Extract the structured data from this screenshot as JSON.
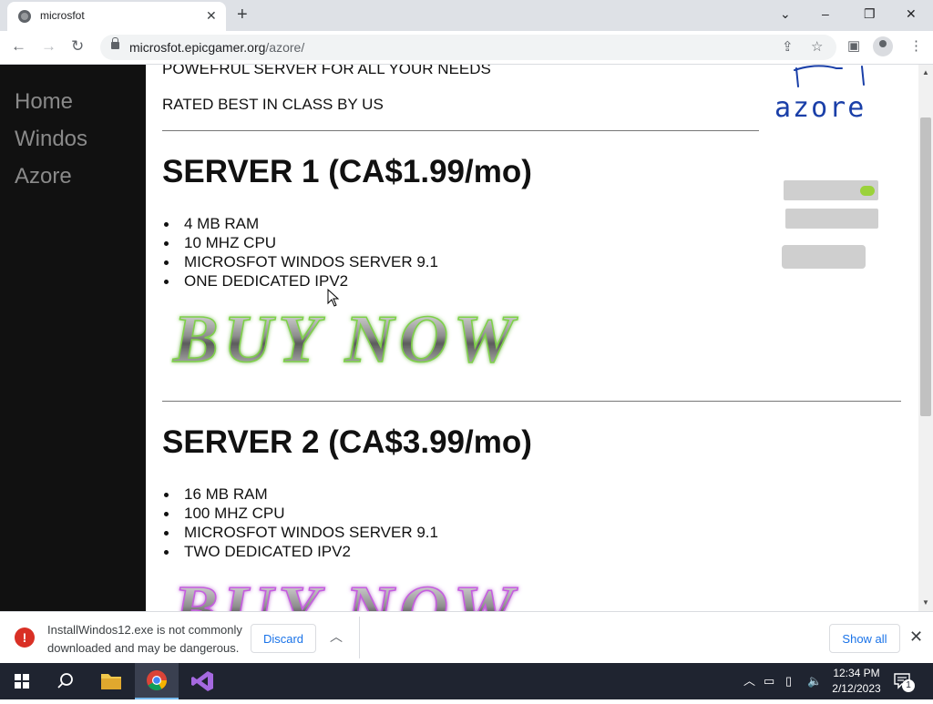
{
  "browser": {
    "tab_title": "microsfot",
    "url_host": "microsfot.epicgamer.org",
    "url_path": "/azore/"
  },
  "sidebar": {
    "items": [
      {
        "label": "Home"
      },
      {
        "label": "Windos"
      },
      {
        "label": "Azore"
      }
    ]
  },
  "page": {
    "tagline": "POWEFRUL SERVER FOR ALL YOUR NEEDS",
    "rating": "RATED BEST IN CLASS BY US",
    "logo_text": "azore",
    "buy_button_text": "BUY NOW",
    "servers": [
      {
        "title": "SERVER 1 (CA$1.99/mo)",
        "features": [
          "4 MB RAM",
          "10 MHZ CPU",
          "MICROSFOT WINDOS SERVER 9.1",
          "ONE DEDICATED IPV2"
        ]
      },
      {
        "title": "SERVER 2 (CA$3.99/mo)",
        "features": [
          "16 MB RAM",
          "100 MHZ CPU",
          "MICROSFOT WINDOS SERVER 9.1",
          "TWO DEDICATED IPV2"
        ]
      }
    ]
  },
  "download_bar": {
    "message_line1": "InstallWindos12.exe is not commonly",
    "message_line2": "downloaded and may be dangerous.",
    "discard_label": "Discard",
    "show_all_label": "Show all"
  },
  "taskbar": {
    "time": "12:34 PM",
    "date": "2/12/2023",
    "notification_count": "1"
  },
  "colors": {
    "sidebar_bg": "#111111",
    "sidebar_link": "#8a8a8a",
    "logo_ink": "#1a3fa8",
    "link_blue": "#1a73e8",
    "warning_red": "#d93025"
  }
}
